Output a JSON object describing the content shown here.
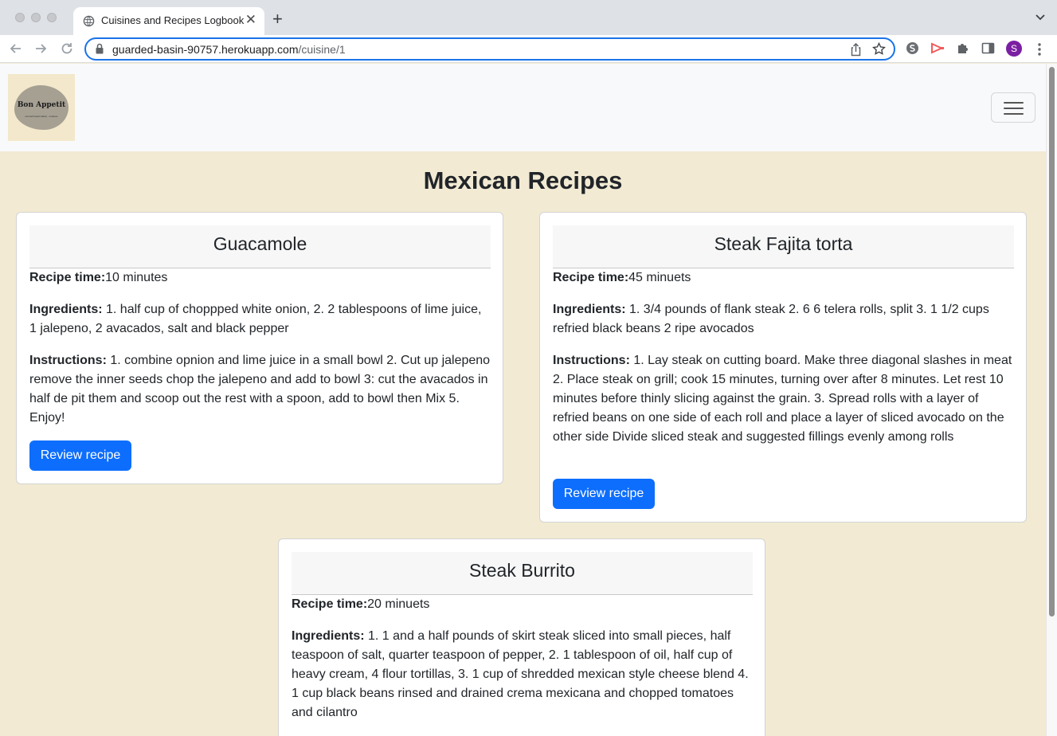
{
  "browser": {
    "tab_title": "Cuisines and Recipes Logbook",
    "close_glyph": "✕",
    "newtab_glyph": "+",
    "url_host": "guarded-basin-90757.herokuapp.com",
    "url_path": "/cuisine/1",
    "profile_initial": "S"
  },
  "navbar": {
    "logo_text": "Bon Appetit",
    "logo_tagline": "eat well travel widely · cuisines"
  },
  "page": {
    "heading": "Mexican Recipes",
    "time_label": "Recipe time:",
    "ingredients_label": "Ingredients:",
    "instructions_label": "Instructions:",
    "review_label": "Review recipe"
  },
  "recipes": [
    {
      "name": "Guacamole",
      "time": "10 minutes",
      "ingredients": " 1. half cup of choppped white onion, 2. 2 tablespoons of lime juice, 1 jalepeno, 2 avacados, salt and black pepper",
      "instructions": " 1. combine opnion and lime juice in a small bowl 2. Cut up jalepeno remove the inner seeds chop the jalepeno and add to bowl 3: cut the avacados in half de pit them and scoop out the rest with a spoon, add to bowl then Mix 5. Enjoy!"
    },
    {
      "name": "Steak Fajita torta",
      "time": "45 minuets",
      "ingredients": " 1. 3/4 pounds of flank steak 2. 6 6 telera rolls, split 3. 1 1/2 cups refried black beans 2 ripe avocados",
      "instructions": " 1. Lay steak on cutting board. Make three diagonal slashes in meat 2. Place steak on grill; cook 15 minutes, turning over after 8 minutes. Let rest 10 minutes before thinly slicing against the grain. 3. Spread rolls with a layer of refried beans on one side of each roll and place a layer of sliced avocado on the other side Divide sliced steak and suggested fillings evenly among rolls"
    },
    {
      "name": "Steak Burrito",
      "time": "20 minuets",
      "ingredients": " 1. 1 and a half pounds of skirt steak sliced into small pieces, half teaspoon of salt, quarter teaspoon of pepper, 2. 1 tablespoon of oil, half cup of heavy cream, 4 flour tortillas, 3. 1 cup of shredded mexican style cheese blend 4. 1 cup black beans rinsed and drained crema mexicana and chopped tomatoes and cilantro"
    }
  ],
  "colors": {
    "page_bg": "#f2ead3",
    "button": "#0d6efd",
    "omnibox_focus": "#1a73e8",
    "profile": "#7b1fa2"
  }
}
